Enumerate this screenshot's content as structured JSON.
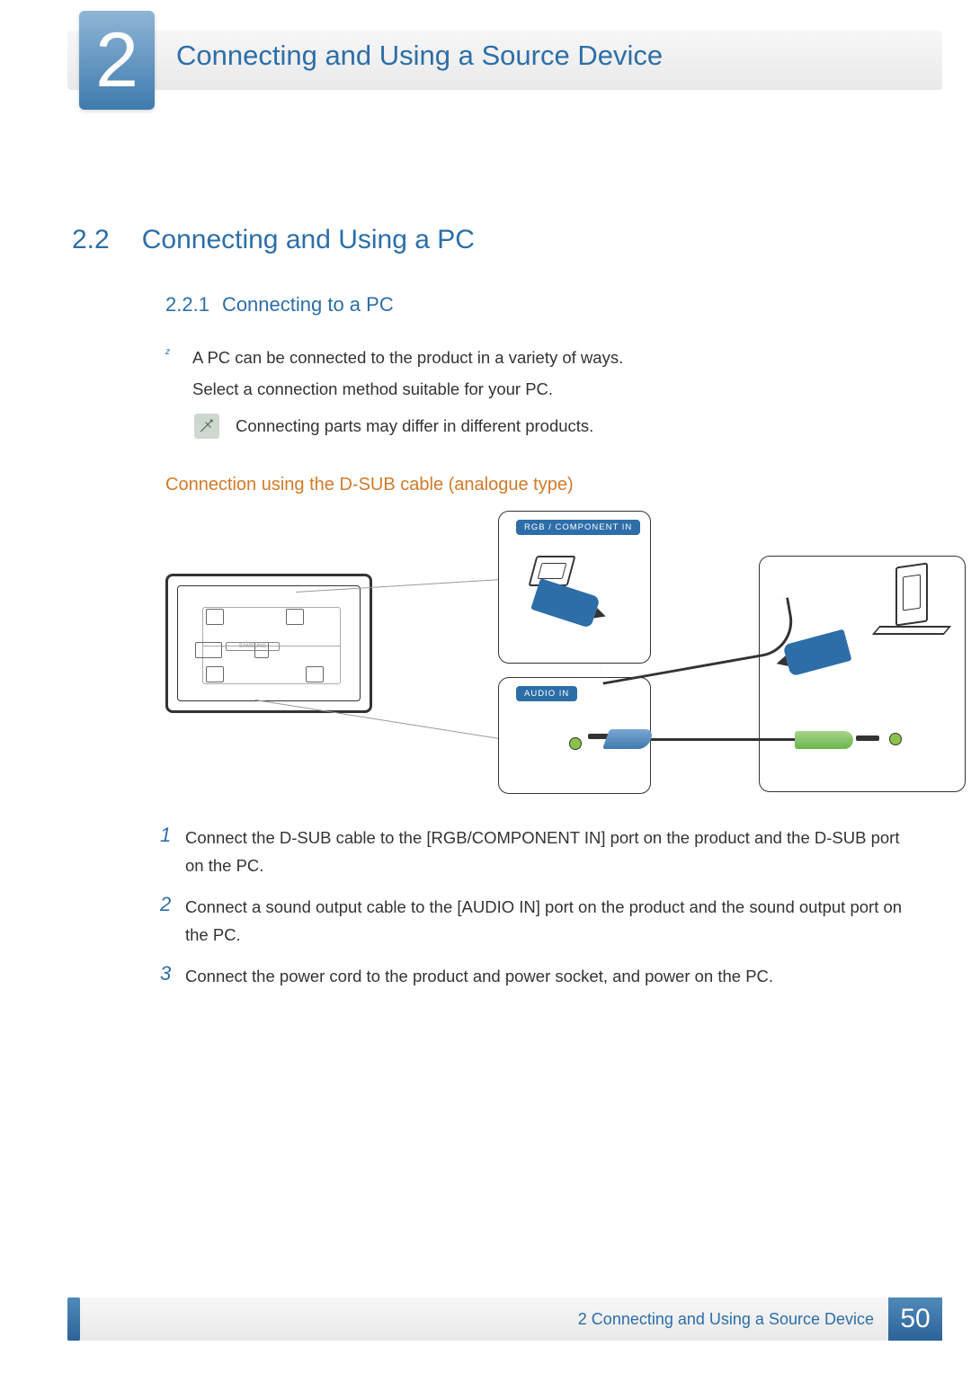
{
  "header": {
    "chapter_number": "2",
    "chapter_title": "Connecting and Using a Source Device"
  },
  "section": {
    "number": "2.2",
    "title": "Connecting and Using a PC"
  },
  "subsection": {
    "number": "2.2.1",
    "title": "Connecting to a PC"
  },
  "bullet": {
    "mark": "z",
    "line1": "A PC can be connected to the product in a variety of ways.",
    "line2": "Select a connection method suitable for your PC."
  },
  "note": {
    "text": "Connecting parts may differ in different products."
  },
  "subheading": "Connection using the D-SUB cable (analogue type)",
  "diagram": {
    "label_video": "RGB / COMPONENT IN",
    "label_audio": "AUDIO IN",
    "brand": "SAMSUNG"
  },
  "steps": [
    {
      "n": "1",
      "t": "Connect the D-SUB cable to the [RGB/COMPONENT IN] port on the product and the D-SUB port on the PC."
    },
    {
      "n": "2",
      "t": "Connect a sound output cable to the [AUDIO IN] port on the product and the sound output port on the PC."
    },
    {
      "n": "3",
      "t": "Connect the power cord to the product and power socket, and power on the PC."
    }
  ],
  "footer": {
    "text": "2 Connecting and Using a Source Device",
    "page": "50"
  }
}
